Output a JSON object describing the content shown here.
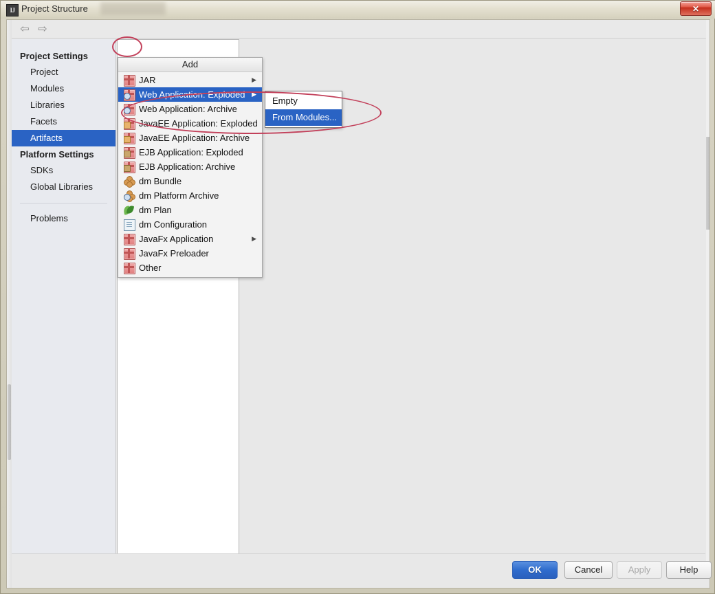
{
  "window": {
    "title": "Project Structure",
    "app_icon": "IJ",
    "close_label": "✕"
  },
  "toolbar": {
    "back_icon": "⇦",
    "forward_icon": "⇨",
    "add_icon": "plus-icon",
    "remove_icon": "minus-icon"
  },
  "sidebar": {
    "groups": [
      {
        "label": "Project Settings",
        "items": [
          {
            "label": "Project",
            "selected": false
          },
          {
            "label": "Modules",
            "selected": false
          },
          {
            "label": "Libraries",
            "selected": false
          },
          {
            "label": "Facets",
            "selected": false
          },
          {
            "label": "Artifacts",
            "selected": true
          }
        ]
      },
      {
        "label": "Platform Settings",
        "items": [
          {
            "label": "SDKs",
            "selected": false
          },
          {
            "label": "Global Libraries",
            "selected": false
          }
        ]
      }
    ],
    "extra": [
      {
        "label": "Problems",
        "selected": false
      }
    ]
  },
  "menu": {
    "header": "Add",
    "items": [
      {
        "label": "JAR",
        "icon": "artifact-icon",
        "badge": "none",
        "arrow": true,
        "selected": false
      },
      {
        "label": "Web Application: Exploded",
        "icon": "artifact-icon",
        "badge": "blue",
        "arrow": true,
        "selected": true
      },
      {
        "label": "Web Application: Archive",
        "icon": "artifact-icon",
        "badge": "blue",
        "arrow": false,
        "selected": false
      },
      {
        "label": "JavaEE Application: Exploded",
        "icon": "artifact-icon",
        "badge": "orange",
        "arrow": false,
        "selected": false
      },
      {
        "label": "JavaEE Application: Archive",
        "icon": "artifact-icon",
        "badge": "orange",
        "arrow": false,
        "selected": false
      },
      {
        "label": "EJB Application: Exploded",
        "icon": "artifact-icon",
        "badge": "tan",
        "arrow": false,
        "selected": false
      },
      {
        "label": "EJB Application: Archive",
        "icon": "artifact-icon",
        "badge": "tan",
        "arrow": false,
        "selected": false
      },
      {
        "label": "dm Bundle",
        "icon": "dm-bundle-icon",
        "badge": "none",
        "arrow": false,
        "selected": false
      },
      {
        "label": "dm Platform Archive",
        "icon": "dm-bundle-icon",
        "badge": "blue",
        "arrow": false,
        "selected": false
      },
      {
        "label": "dm Plan",
        "icon": "dm-plan-icon",
        "badge": "none",
        "arrow": false,
        "selected": false
      },
      {
        "label": "dm Configuration",
        "icon": "document-icon",
        "badge": "none",
        "arrow": false,
        "selected": false
      },
      {
        "label": "JavaFx Application",
        "icon": "artifact-icon",
        "badge": "none",
        "arrow": true,
        "selected": false
      },
      {
        "label": "JavaFx Preloader",
        "icon": "artifact-icon",
        "badge": "none",
        "arrow": false,
        "selected": false
      },
      {
        "label": "Other",
        "icon": "artifact-icon",
        "badge": "none",
        "arrow": false,
        "selected": false
      }
    ]
  },
  "submenu": {
    "items": [
      {
        "label": "Empty",
        "selected": false
      },
      {
        "label": "From Modules...",
        "selected": true
      }
    ]
  },
  "buttons": {
    "ok": "OK",
    "cancel": "Cancel",
    "apply": "Apply",
    "help": "Help"
  },
  "annotations": {
    "accent_color": "#c2405a",
    "marks": [
      {
        "name": "add-button-highlight",
        "shape": "ellipse"
      },
      {
        "name": "submenu-highlight",
        "shape": "ellipse"
      }
    ]
  },
  "colors": {
    "selection_blue": "#2a63c4",
    "primary_button": "#2f6ccd",
    "annotation_red": "#c2405a",
    "sidebar_bg": "#e8eaef",
    "dialog_bg": "#e8e8e8"
  }
}
